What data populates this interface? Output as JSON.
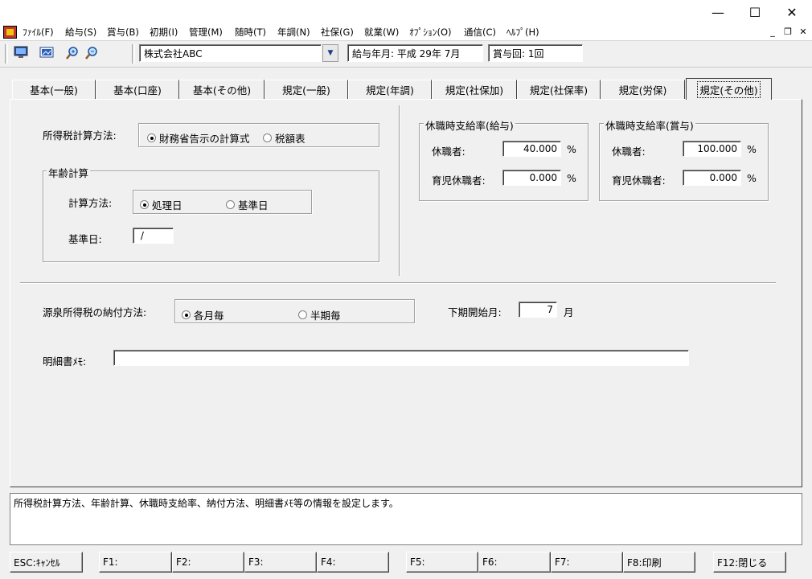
{
  "window": {
    "minimize_glyph": "—",
    "maximize_glyph": "☐",
    "close_glyph": "✕"
  },
  "menu": {
    "items": [
      "ﾌｧｲﾙ(F)",
      "給与(S)",
      "賞与(B)",
      "初期(I)",
      "管理(M)",
      "随時(T)",
      "年調(N)",
      "社保(G)",
      "就業(W)",
      "ｵﾌﾟｼｮﾝ(O)",
      "通信(C)",
      "ﾍﾙﾌﾟ(H)"
    ],
    "mdi_minimize": "_",
    "mdi_restore": "❐",
    "mdi_close": "✕"
  },
  "toolbar": {
    "icons": [
      "monitor-icon",
      "image-icon",
      "zoom-in-icon",
      "zoom-out-icon"
    ],
    "company": "株式会社ABC",
    "dropdown_glyph": "▼",
    "pay_period": "給与年月: 平成 29年  7月",
    "bonus_count": "賞与回: 1回"
  },
  "tabs": [
    "基本(一般)",
    "基本(口座)",
    "基本(その他)",
    "規定(一般)",
    "規定(年調)",
    "規定(社保加)",
    "規定(社保率)",
    "規定(労保)",
    "規定(その他)"
  ],
  "active_tab": "規定(その他)",
  "income_tax": {
    "label": "所得税計算方法:",
    "options": [
      "財務省告示の計算式",
      "税額表"
    ],
    "selected": "財務省告示の計算式"
  },
  "age_calc": {
    "legend": "年齢計算",
    "method_label": "計算方法:",
    "options": [
      "処理日",
      "基準日"
    ],
    "selected": "処理日",
    "base_date_label": "基準日:",
    "base_date_value": " /"
  },
  "leave_salary": {
    "legend": "休職時支給率(給与)",
    "leave_label": "休職者:",
    "leave_value": "40.000",
    "childcare_label": "育児休職者:",
    "childcare_value": "0.000",
    "unit": "%"
  },
  "leave_bonus": {
    "legend": "休職時支給率(賞与)",
    "leave_label": "休職者:",
    "leave_value": "100.000",
    "childcare_label": "育児休職者:",
    "childcare_value": "0.000",
    "unit": "%"
  },
  "withholding": {
    "label": "源泉所得税の納付方法:",
    "options": [
      "各月毎",
      "半期毎"
    ],
    "selected": "各月毎",
    "second_half_label": "下期開始月:",
    "second_half_value": "7",
    "month_unit": "月"
  },
  "memo": {
    "label": "明細書ﾒﾓ:",
    "value": ""
  },
  "status_message": "所得税計算方法、年齢計算、休職時支給率、納付方法、明細書ﾒﾓ等の情報を設定します。",
  "function_keys": [
    "ESC:ｷｬﾝｾﾙ",
    "F1:",
    "F2:",
    "F3:",
    "F4:",
    "F5:",
    "F6:",
    "F7:",
    "F8:印刷",
    "F12:閉じる"
  ]
}
